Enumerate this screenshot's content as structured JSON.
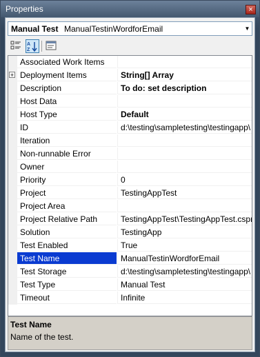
{
  "window": {
    "title": "Properties",
    "close_glyph": "×"
  },
  "object_selector": {
    "name": "Manual Test",
    "type": "ManualTestinWordforEmail",
    "dropdown_glyph": "▼"
  },
  "toolbar": {
    "icons": [
      "categorized-icon",
      "alphabetical-icon",
      "property-pages-icon"
    ]
  },
  "properties": [
    {
      "name": "Associated Work Items",
      "value": "",
      "bold": false,
      "expandable": false
    },
    {
      "name": "Deployment Items",
      "value": "String[] Array",
      "bold": true,
      "expandable": true,
      "expander_glyph": "+"
    },
    {
      "name": "Description",
      "value": "To do: set description",
      "bold": true,
      "expandable": false
    },
    {
      "name": "Host Data",
      "value": "",
      "bold": false,
      "expandable": false
    },
    {
      "name": "Host Type",
      "value": "Default",
      "bold": true,
      "expandable": false
    },
    {
      "name": "ID",
      "value": "d:\\testing\\sampletesting\\testingapp\\",
      "bold": false,
      "expandable": false
    },
    {
      "name": "Iteration",
      "value": "",
      "bold": false,
      "expandable": false
    },
    {
      "name": "Non-runnable Error",
      "value": "",
      "bold": false,
      "expandable": false
    },
    {
      "name": "Owner",
      "value": "",
      "bold": false,
      "expandable": false
    },
    {
      "name": "Priority",
      "value": "0",
      "bold": false,
      "expandable": false
    },
    {
      "name": "Project",
      "value": "TestingAppTest",
      "bold": false,
      "expandable": false
    },
    {
      "name": "Project Area",
      "value": "",
      "bold": false,
      "expandable": false
    },
    {
      "name": "Project Relative Path",
      "value": "TestingAppTest\\TestingAppTest.cspr",
      "bold": false,
      "expandable": false
    },
    {
      "name": "Solution",
      "value": "TestingApp",
      "bold": false,
      "expandable": false
    },
    {
      "name": "Test Enabled",
      "value": "True",
      "bold": false,
      "expandable": false
    },
    {
      "name": "Test Name",
      "value": "ManualTestinWordforEmail",
      "bold": false,
      "expandable": false,
      "selected": true
    },
    {
      "name": "Test Storage",
      "value": "d:\\testing\\sampletesting\\testingapp\\",
      "bold": false,
      "expandable": false
    },
    {
      "name": "Test Type",
      "value": "Manual Test",
      "bold": false,
      "expandable": false
    },
    {
      "name": "Timeout",
      "value": "Infinite",
      "bold": false,
      "expandable": false
    }
  ],
  "description": {
    "title": "Test Name",
    "text": "Name of the test."
  }
}
